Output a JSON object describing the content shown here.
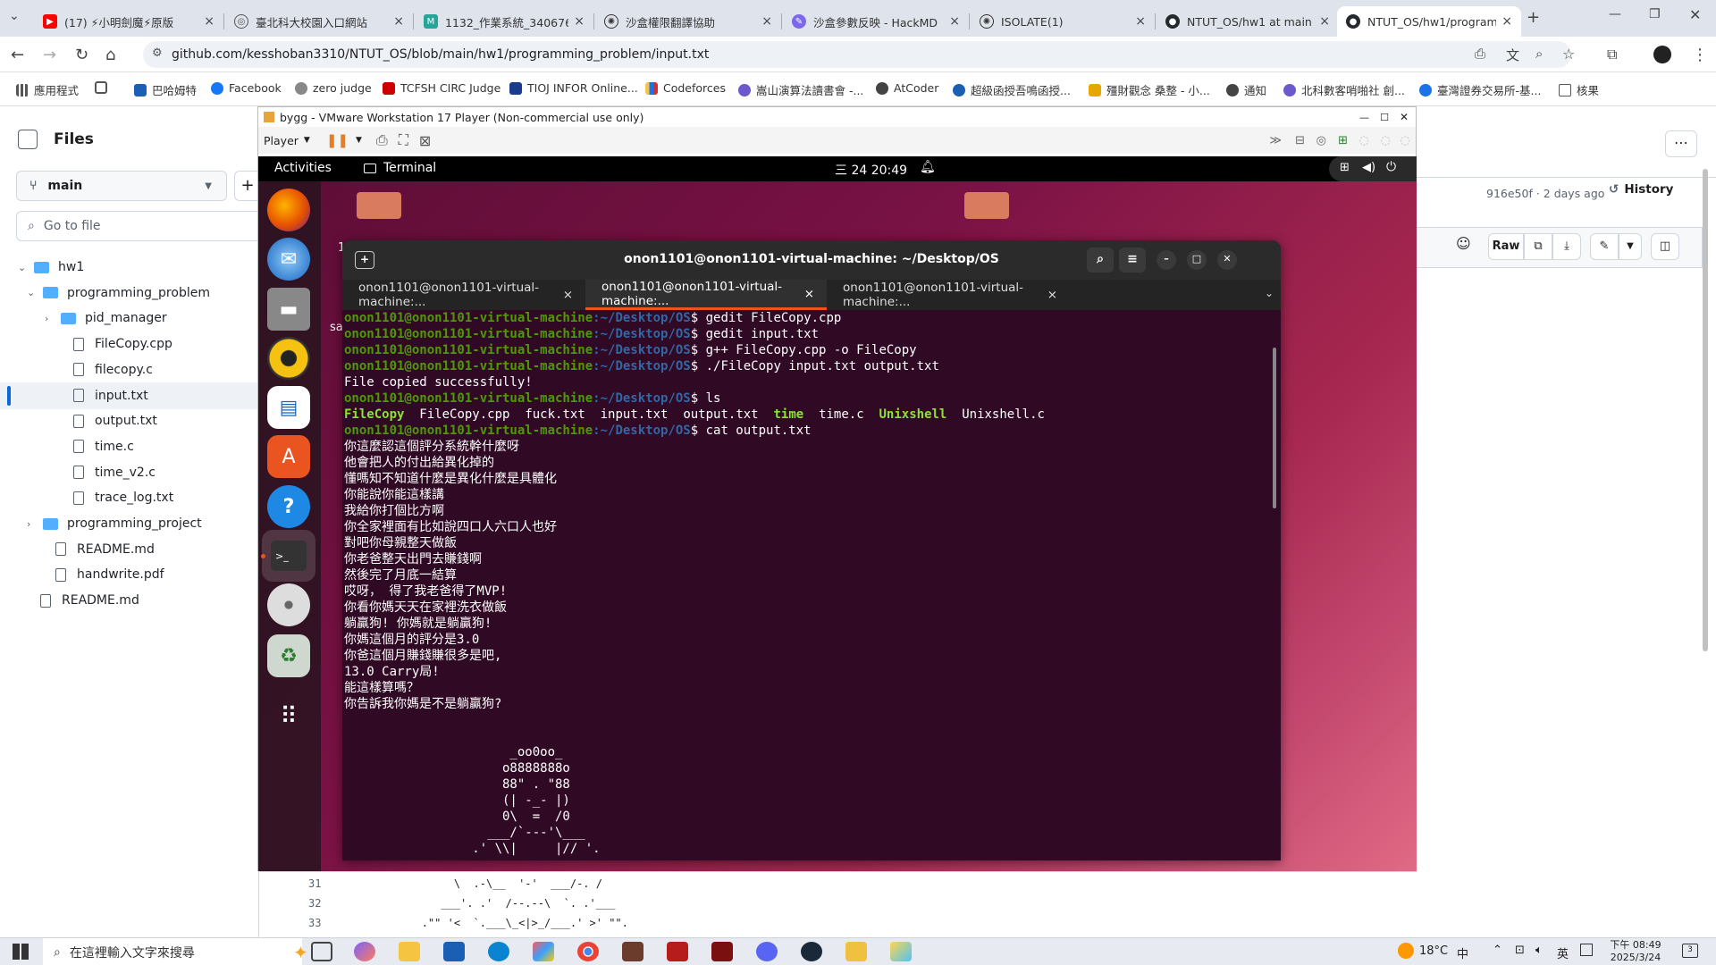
{
  "browser": {
    "tabs": [
      {
        "title": "(17) ⚡小明劍魔⚡原版",
        "active": false
      },
      {
        "title": "臺北科大校園入口網站",
        "active": false
      },
      {
        "title": "1132_作業系統_340676",
        "active": false
      },
      {
        "title": "沙盒權限翻譯協助",
        "active": false
      },
      {
        "title": "沙盒參數反映 - HackMD",
        "active": false
      },
      {
        "title": "ISOLATE(1)",
        "active": false
      },
      {
        "title": "NTUT_OS/hw1 at main",
        "active": false
      },
      {
        "title": "NTUT_OS/hw1/program",
        "active": true
      }
    ],
    "url": "github.com/kesshoban3310/NTUT_OS/blob/main/hw1/programming_problem/input.txt",
    "bookmarks": [
      "應用程式",
      "巴哈姆特",
      "Facebook",
      "zero judge",
      "TCFSH CIRC Judge",
      "TIOJ INFOR Online...",
      "Codeforces",
      "嵩山演算法讀書會 -...",
      "AtCoder",
      "超級函授吾鳴函授...",
      "殭財觀念 桑整 - 小...",
      "通知",
      "北科數客哨啪社 創...",
      "臺灣證券交易所-基...",
      "核果"
    ]
  },
  "github": {
    "files_title": "Files",
    "branch": "main",
    "goto_placeholder": "Go to file",
    "tree": [
      {
        "label": "hw1",
        "type": "folder",
        "level": 0,
        "chevron": "⌄"
      },
      {
        "label": "programming_problem",
        "type": "folder",
        "level": 1,
        "chevron": "⌄"
      },
      {
        "label": "pid_manager",
        "type": "folder",
        "level": 2,
        "chevron": "›"
      },
      {
        "label": "FileCopy.cpp",
        "type": "file",
        "level": 2
      },
      {
        "label": "filecopy.c",
        "type": "file",
        "level": 2
      },
      {
        "label": "input.txt",
        "type": "file",
        "level": 2,
        "selected": true
      },
      {
        "label": "output.txt",
        "type": "file",
        "level": 2
      },
      {
        "label": "time.c",
        "type": "file",
        "level": 2
      },
      {
        "label": "time_v2.c",
        "type": "file",
        "level": 2
      },
      {
        "label": "trace_log.txt",
        "type": "file",
        "level": 2
      },
      {
        "label": "programming_project",
        "type": "folder",
        "level": 1,
        "chevron": "›"
      },
      {
        "label": "README.md",
        "type": "file",
        "level": 1
      },
      {
        "label": "handwrite.pdf",
        "type": "file",
        "level": 1
      },
      {
        "label": "README.md",
        "type": "file",
        "level": 0
      }
    ],
    "commit": "916e50f · 2 days ago",
    "history": "History",
    "raw": "Raw",
    "code_lines": [
      {
        "n": "31",
        "text": "                 \\  .-\\__  '-'  ___/-. /"
      },
      {
        "n": "32",
        "text": "               ___'. .'  /--.--\\  `. .'___"
      },
      {
        "n": "33",
        "text": "            .\"\" '<  `.___\\_<|>_/___.' >' \"\"."
      }
    ]
  },
  "vmware": {
    "title": "bygg - VMware Workstation 17 Player (Non-commercial use only)",
    "player": "Player"
  },
  "ubuntu": {
    "activities": "Activities",
    "app": "Terminal",
    "clock": "三 24  20:49",
    "term_title": "onon1101@onon1101-virtual-machine: ~/Desktop/OS",
    "term_tabs": [
      "onon1101@onon1101-virtual-machine:...",
      "onon1101@onon1101-virtual-machine:...",
      "onon1101@onon1101-virtual-machine:..."
    ],
    "prompt_user": "onon1101@onon1101-virtual-machine",
    "prompt_path": ":~/Desktop/OS",
    "commands": [
      "gedit FileCopy.cpp",
      "gedit input.txt",
      "g++ FileCopy.cpp -o FileCopy",
      "./FileCopy input.txt output.txt"
    ],
    "copied": "File copied successfully!",
    "cmd_ls": "ls",
    "ls_items": [
      {
        "name": "FileCopy",
        "kind": "exec"
      },
      {
        "name": "FileCopy.cpp",
        "kind": "file"
      },
      {
        "name": "fuck.txt",
        "kind": "file"
      },
      {
        "name": "input.txt",
        "kind": "file"
      },
      {
        "name": "output.txt",
        "kind": "file"
      },
      {
        "name": "time",
        "kind": "exec"
      },
      {
        "name": "time.c",
        "kind": "file"
      },
      {
        "name": "Unixshell",
        "kind": "exec"
      },
      {
        "name": "Unixshell.c",
        "kind": "file"
      }
    ],
    "cmd_cat": "cat output.txt",
    "output_lines": [
      "你這麼認這個評分系統幹什麼呀",
      "他會把人的付出給異化掉的",
      "懂嗎知不知道什麼是異化什麼是具體化",
      "你能說你能這樣講",
      "我給你打個比方啊",
      "你全家裡面有比如說四口人六口人也好",
      "對吧你母親整天做飯",
      "你老爸整天出門去賺錢啊",
      "然後完了月底一結算",
      "哎呀， 得了我老爸得了MVP!",
      "你看你媽天天在家裡洗衣做飯",
      "躺贏狗! 你媽就是躺贏狗!",
      "你媽這個月的評分是3.0",
      "你爸這個月賺錢賺很多是吧,",
      "13.0 Carry局!",
      "能這樣算嗎？",
      "你告訴我你媽是不是躺贏狗?",
      "",
      "",
      "                      _oo0oo_",
      "                     o8888888o",
      "                     88\" . \"88",
      "                     (| -_- |)",
      "                     0\\  =  /0",
      "                   ___/`---'\\___",
      "                 .' \\\\|     |// '."
    ],
    "side_num": "1",
    "side_text": "sa"
  },
  "taskbar": {
    "search_placeholder": "在這裡輸入文字來搜尋",
    "weather": "18°C",
    "ime": "英",
    "time_period": "下午 08:49",
    "date": "2025/3/24",
    "notif_count": "3",
    "input_method": "中"
  }
}
